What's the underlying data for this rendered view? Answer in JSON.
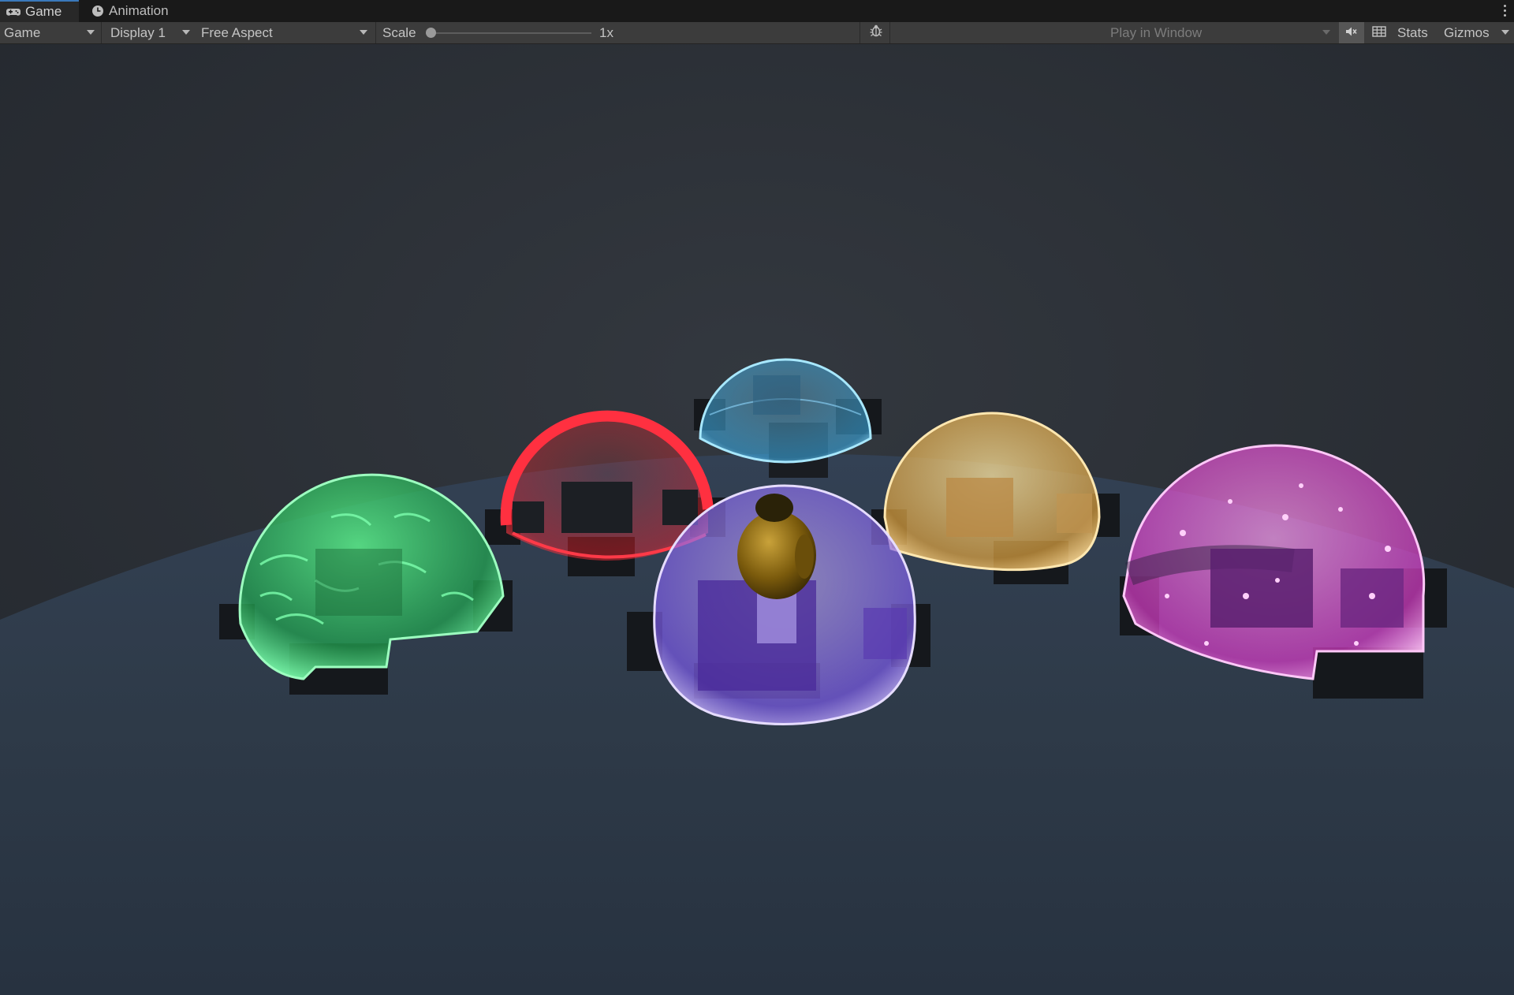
{
  "tabs": [
    {
      "label": "Game",
      "icon": "gamepad-icon",
      "active": true
    },
    {
      "label": "Animation",
      "icon": "clock-icon",
      "active": false
    }
  ],
  "toolbar": {
    "view_mode": "Game",
    "display": "Display 1",
    "aspect": "Free Aspect",
    "scale_label": "Scale",
    "scale_value": "1x",
    "scale_fraction": 0,
    "play_mode": "Play in Window",
    "stats_label": "Stats",
    "gizmos_label": "Gizmos",
    "debug_icon": "bug-icon",
    "mute_icon": "mute-audio-icon",
    "aspect_grid_icon": "grid-icon"
  },
  "scene": {
    "background_color": "#2b2f35",
    "ground_color": "#2f3a48",
    "domes": [
      {
        "name": "green-shield-dome",
        "color": "#3ed66f"
      },
      {
        "name": "red-shield-dome",
        "color": "#ff2b35"
      },
      {
        "name": "blue-shield-dome",
        "color": "#5bc4f0"
      },
      {
        "name": "yellow-shield-dome",
        "color": "#f4c45a"
      },
      {
        "name": "purple-shield-dome",
        "color": "#8d6cf0"
      },
      {
        "name": "magenta-shield-dome",
        "color": "#f066e4"
      }
    ],
    "character": {
      "name": "player-character",
      "color": "#8a6a10"
    }
  }
}
